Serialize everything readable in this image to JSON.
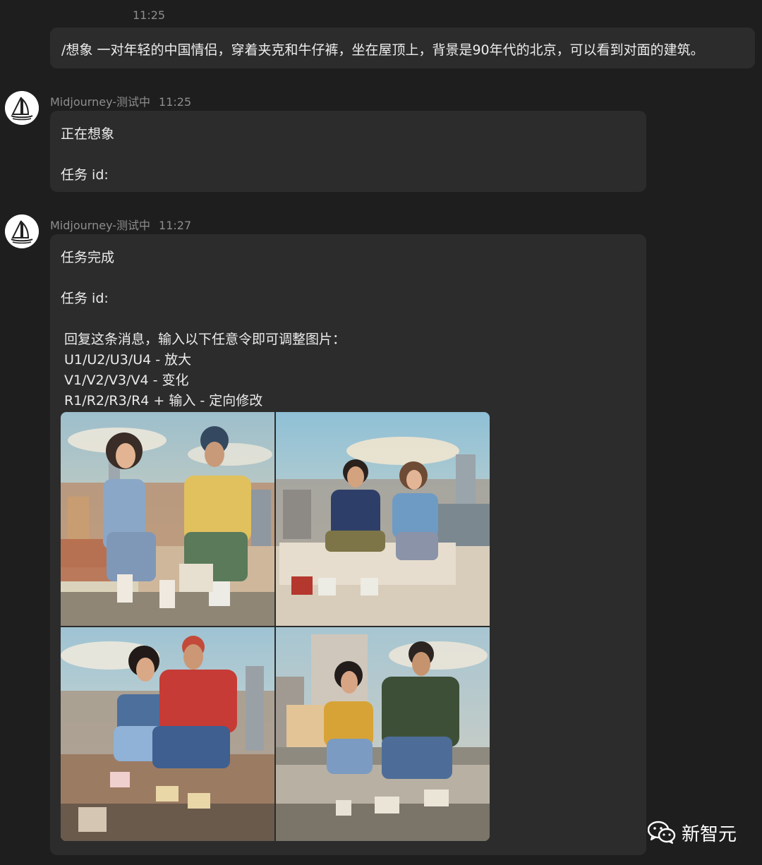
{
  "top_time": "11:25",
  "user_message": "/想象 一对年轻的中国情侣，穿着夹克和牛仔裤，坐在屋顶上，背景是90年代的北京，可以看到对面的建筑。",
  "bot_messages": [
    {
      "sender": "Midjourney-测试中",
      "time": "11:25",
      "lines": [
        "正在想象",
        "任务 id:"
      ]
    },
    {
      "sender": "Midjourney-测试中",
      "time": "11:27",
      "lines": [
        "任务完成",
        "任务 id:",
        "回复这条消息，输入以下任意令即可调整图片：",
        "U1/U2/U3/U4 - 放大",
        "V1/V2/V3/V4 - 变化",
        "R1/R2/R3/R4 + 输入 - 定向修改"
      ],
      "image_grid": {
        "tiles": [
          {
            "icon": "couple-rooftop-image-1"
          },
          {
            "icon": "couple-rooftop-image-2"
          },
          {
            "icon": "couple-rooftop-image-3"
          },
          {
            "icon": "couple-rooftop-image-4"
          }
        ]
      }
    }
  ],
  "watermark": {
    "icon": "wechat-icon",
    "text": "新智元"
  },
  "colors": {
    "background": "#1e1e1e",
    "bubble": "#2c2c2c",
    "muted_text": "#8d8d8d"
  }
}
